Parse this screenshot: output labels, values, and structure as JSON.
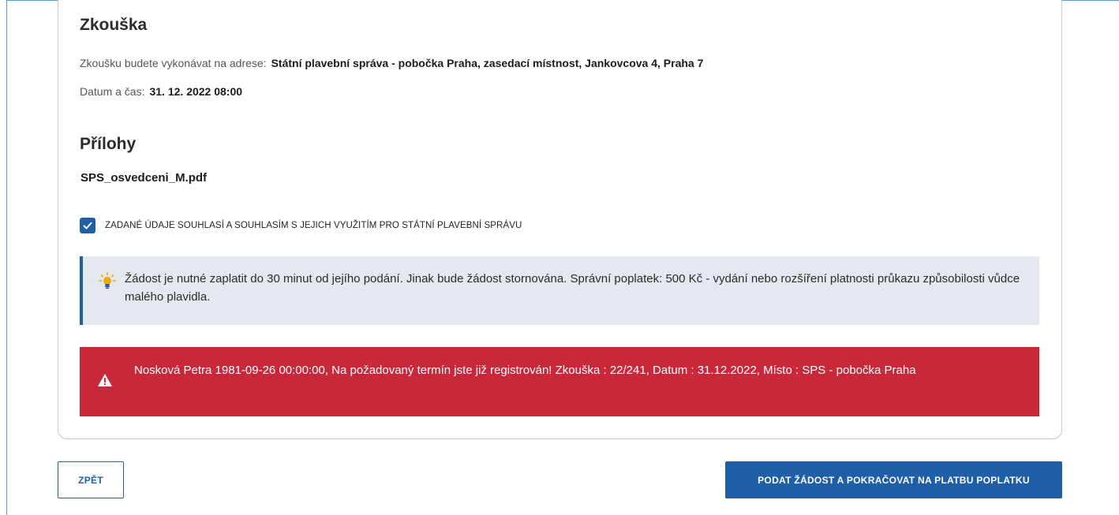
{
  "exam": {
    "heading": "Zkouška",
    "address_label": "Zkoušku budete vykonávat na adrese:",
    "address_value": "Státní plavební správa - pobočka Praha, zasedací místnost, Jankovcova 4, Praha 7",
    "datetime_label": "Datum a čas:",
    "datetime_value": "31. 12. 2022 08:00"
  },
  "attachments": {
    "heading": "Přílohy",
    "file_name": "SPS_osvedceni_M.pdf"
  },
  "consent": {
    "checked": true,
    "label": "ZADANÉ ÚDAJE SOUHLASÍ A SOUHLASÍM S JEJICH VYUŽITÍM PRO STÁTNÍ PLAVEBNÍ SPRÁVU"
  },
  "info_box": {
    "icon": "lightbulb-icon",
    "text": "Žádost je nutné zaplatit do 30 minut od jejího podání. Jinak bude žádost stornována. Správní poplatek: 500 Kč - vydání nebo rozšíření platnosti průkazu způsobilosti vůdce malého plavidla."
  },
  "error_box": {
    "icon": "warning-icon",
    "text": "Nosková Petra 1981-09-26 00:00:00, Na požadovaný termín jste již registrován! Zkouška : 22/241, Datum : 31.12.2022, Místo : SPS - pobočka Praha"
  },
  "buttons": {
    "back_label": "ZPĚT",
    "submit_label": "PODAT ŽÁDOST A POKRAČOVAT NA PLATBU POPLATKU"
  },
  "colors": {
    "primary": "#1f5ea8",
    "error": "#c8283a",
    "info_bg": "#e4e9f0"
  }
}
